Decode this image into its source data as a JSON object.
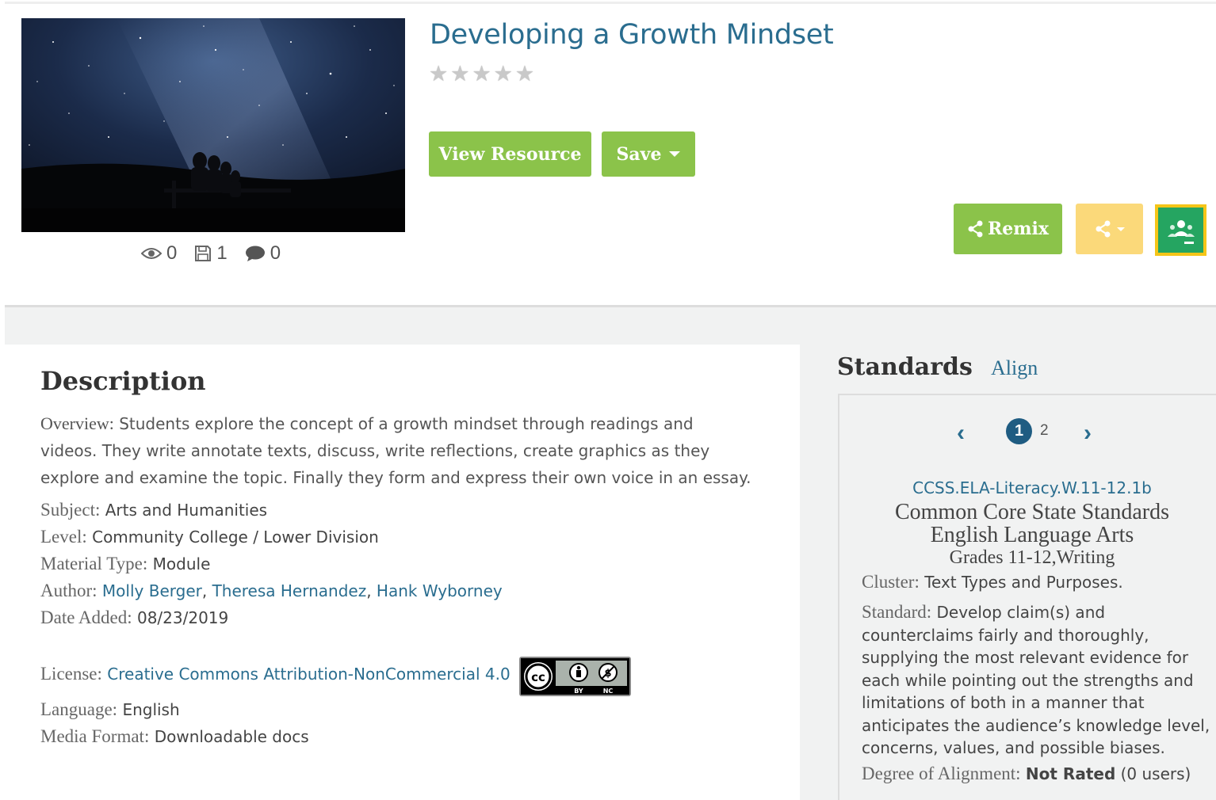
{
  "resource": {
    "title": "Developing a Growth Mindset",
    "rating_stars": 5,
    "rating_value": 0,
    "buttons": {
      "view": "View Resource",
      "save": "Save",
      "remix": "Remix"
    },
    "stats": {
      "views": "0",
      "saves": "1",
      "comments": "0"
    }
  },
  "description": {
    "heading": "Description",
    "overview_label": "Overview:",
    "overview_text": " Students explore the concept of a growth mindset through readings and videos. They write annotate texts, discuss, write reflections, create graphics as they explore and examine the topic. Finally they form and express their own voice in an essay.",
    "subject_label": "Subject:",
    "subject": "Arts and Humanities",
    "level_label": "Level:",
    "level": "Community College / Lower Division",
    "material_label": "Material Type:",
    "material": "Module",
    "author_label": "Author:",
    "authors": [
      "Molly Berger",
      "Theresa Hernandez",
      "Hank Wyborney"
    ],
    "date_label": "Date Added:",
    "date": "08/23/2019",
    "license_label": "License:",
    "license": "Creative Commons Attribution-NonCommercial 4.0",
    "language_label": "Language:",
    "language": "English",
    "media_label": "Media Format:",
    "media": "Downloadable docs"
  },
  "standards": {
    "heading": "Standards",
    "align_link": "Align",
    "pages": [
      "1",
      "2"
    ],
    "current_page": "1",
    "code": "CCSS.ELA-Literacy.W.11-12.1b",
    "name_line1": "Common Core State Standards",
    "name_line2": "English Language Arts",
    "grades": "Grades 11-12,Writing",
    "cluster_label": "Cluster:",
    "cluster": "Text Types and Purposes.",
    "standard_label": "Standard:",
    "standard_text": " Develop claim(s) and counterclaims fairly and thoroughly, supplying the most relevant evidence for each while pointing out the strengths and limitations of both in a manner that anticipates the audience’s knowledge level, concerns, values, and possible biases.",
    "degree_label": "Degree of Alignment:",
    "degree_value": "Not Rated",
    "degree_users": "(0 users)"
  },
  "colors": {
    "accent_blue": "#2a6d8f",
    "green": "#8bc34a",
    "yellow": "#fbd97a",
    "classroom_green": "#25a561"
  },
  "icons": {
    "views": "eye-icon",
    "saves": "floppy-icon",
    "comments": "comment-icon",
    "share": "share-icon",
    "classroom": "google-classroom-icon",
    "license_badge": "cc-by-nc-icon"
  }
}
